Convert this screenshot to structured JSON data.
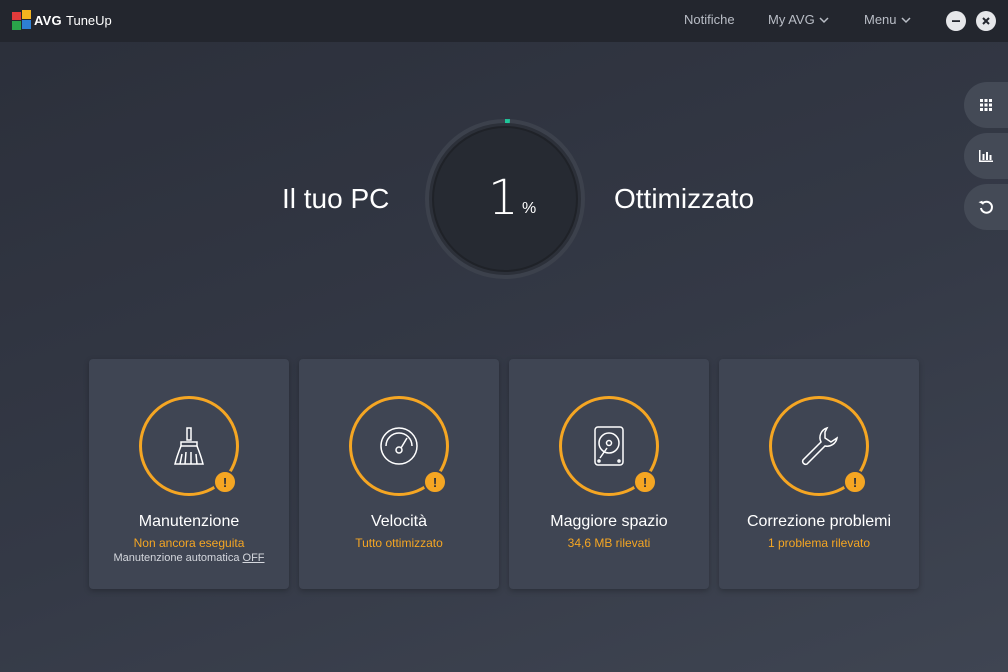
{
  "titlebar": {
    "brand": "AVG",
    "product": "TuneUp",
    "nav": {
      "notifications": "Notifiche",
      "my_avg": "My AVG",
      "menu": "Menu"
    }
  },
  "side_buttons": [
    {
      "icon": "apps-grid-icon"
    },
    {
      "icon": "performance-chart-icon"
    },
    {
      "icon": "undo-icon"
    }
  ],
  "hero": {
    "left_text": "Il tuo PC",
    "value": "1",
    "unit": "%",
    "right_text": "Ottimizzato",
    "progress_fraction": 0.01
  },
  "colors": {
    "accent": "#f5a623",
    "progress": "#1fc69a",
    "card_bg": "#3f4553"
  },
  "cards": [
    {
      "icon": "broom-icon",
      "title": "Manutenzione",
      "status": "Non ancora eseguita",
      "sub_label": "Manutenzione automatica",
      "sub_value": "OFF"
    },
    {
      "icon": "speedometer-icon",
      "title": "Velocità",
      "status": "Tutto ottimizzato"
    },
    {
      "icon": "hard-drive-icon",
      "title": "Maggiore spazio",
      "status": "34,6 MB rilevati"
    },
    {
      "icon": "wrench-icon",
      "title": "Correzione problemi",
      "status": "1 problema rilevato"
    }
  ]
}
